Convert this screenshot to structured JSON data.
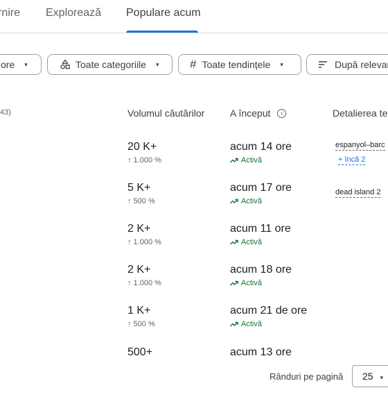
{
  "tabs": {
    "items": [
      {
        "label": "rnire"
      },
      {
        "label": "Explorează"
      },
      {
        "label": "Populare acum",
        "active": true
      }
    ]
  },
  "filters": {
    "chip1_label": "ore",
    "chip2_label": "Toate categoriile",
    "chip3_label": "Toate tendințele",
    "chip4_label": "După relevanță",
    "caret": "▾"
  },
  "table": {
    "count_label": "43)",
    "headers": {
      "volume": "Volumul căutărilor",
      "started": "A început",
      "info": "i",
      "breakdown": "Detalierea ten"
    },
    "rows": [
      {
        "volume": "20 K+",
        "pct": "↑ 1.000 %",
        "started": "acum 14 ore",
        "status": "Activă",
        "breakdown": "espanyol–barc",
        "more": "+ încă 2"
      },
      {
        "volume": "5 K+",
        "pct": "↑ 500 %",
        "started": "acum 17 ore",
        "status": "Activă",
        "breakdown": "dead island 2"
      },
      {
        "volume": "2 K+",
        "pct": "↑ 1.000 %",
        "started": "acum 11 ore",
        "status": "Activă"
      },
      {
        "volume": "2 K+",
        "pct": "↑ 1.000 %",
        "started": "acum 18 ore",
        "status": "Activă"
      },
      {
        "volume": "1 K+",
        "pct": "↑ 500 %",
        "started": "acum 21 de ore",
        "status": "Activă"
      },
      {
        "volume": "500+",
        "started": "acum 13 ore"
      }
    ]
  },
  "footer": {
    "rows_per_page_label": "Rânduri pe pagină",
    "rows_per_page_value": "25"
  },
  "colors": {
    "accent": "#1a73e8",
    "active_status": "#137333",
    "border": "#9aa0a6"
  },
  "icons": {
    "categories": "category-shapes-icon",
    "trends": "hash-icon",
    "sort": "sort-lines-icon",
    "trending": "trending-up-icon",
    "info": "info-icon"
  }
}
